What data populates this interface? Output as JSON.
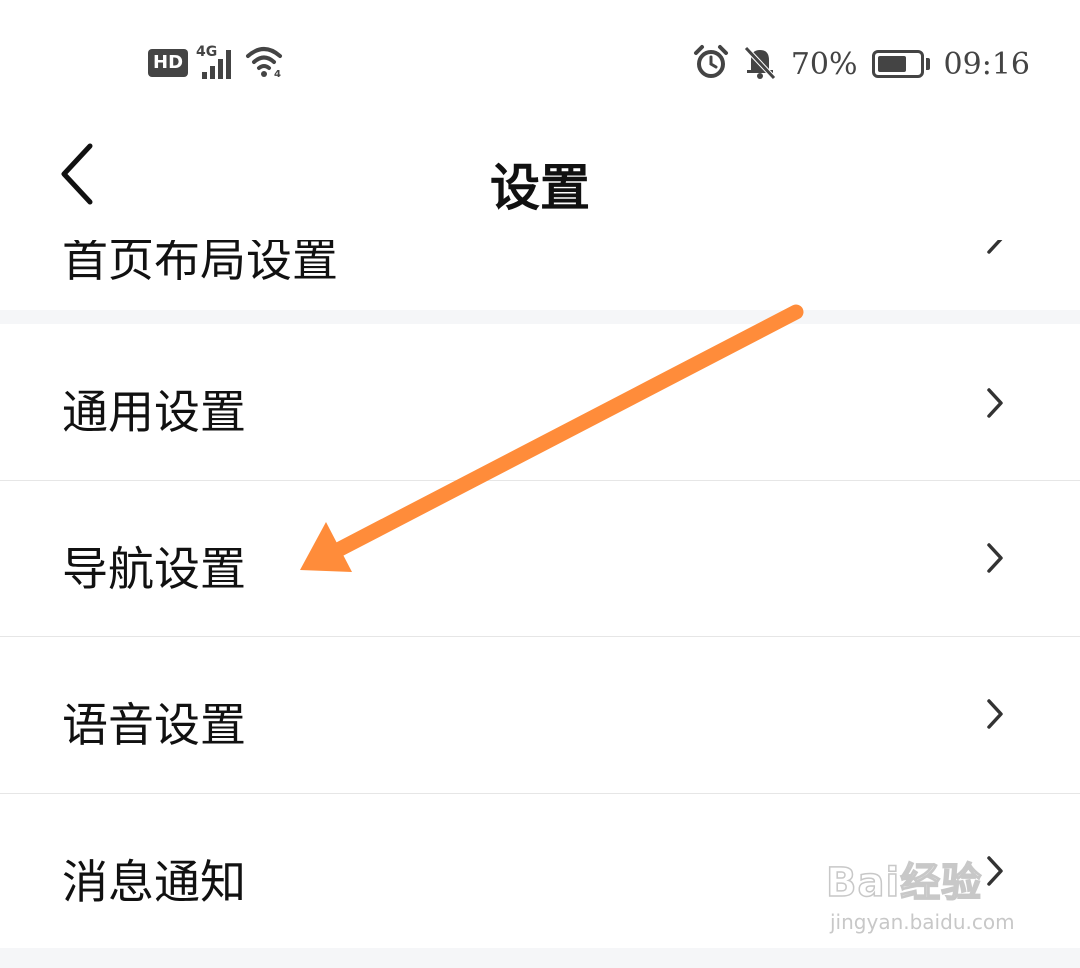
{
  "status_bar": {
    "hd": "HD",
    "network": "4G",
    "battery_percent": "70%",
    "battery_level": 0.7,
    "time": "09:16",
    "icons": [
      "hd-icon",
      "signal-icon",
      "wifi-icon",
      "alarm-icon",
      "bell-off-icon",
      "battery-icon"
    ]
  },
  "nav": {
    "title": "设置",
    "back_icon": "chevron-left-icon"
  },
  "list": {
    "partial_item": {
      "label": "首页布局设置"
    },
    "items": [
      {
        "label": "通用设置"
      },
      {
        "label": "导航设置"
      },
      {
        "label": "语音设置"
      },
      {
        "label": "消息通知"
      }
    ]
  },
  "colors": {
    "arrow": "#ff8c3a",
    "section_gap": "#f5f6f8",
    "divider": "#e6e6e6",
    "text": "#111111"
  },
  "watermark": {
    "brand": "Bai经验",
    "url": "jingyan.baidu.com"
  }
}
